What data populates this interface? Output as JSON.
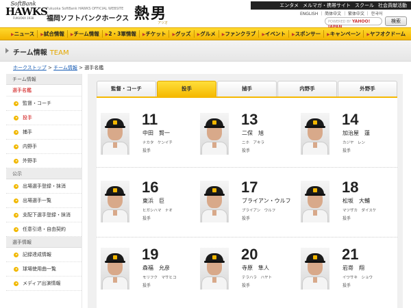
{
  "header": {
    "logo_line1": "SoftBank",
    "logo_line2": "HAWKS",
    "logo_line3": "FUKUOKA 1938",
    "site_tagline": "Fukuoka SoftBank HAWKS OFFICIAL WEBSITE",
    "site_name": "福岡ソフトバンクホークス",
    "hero_title": "熱男",
    "hero_sub": "アツオ",
    "top_links": [
      "エンタメ",
      "メルマガ・携帯サイト",
      "スクール",
      "社会貢献活動"
    ],
    "languages": "ENGLISH ｜ 简体中文 ｜ 繁体中文 ｜ 한국어",
    "search_placeholder": "POWERED BY",
    "search_brand": "YAHOO! JAPAN",
    "search_button": "検索"
  },
  "global_nav": [
    {
      "label": "ニュース"
    },
    {
      "label": "試合情報"
    },
    {
      "label": "チーム情報"
    },
    {
      "label": "2・3軍情報"
    },
    {
      "label": "チケット"
    },
    {
      "label": "グッズ"
    },
    {
      "label": "グルメ"
    },
    {
      "label": "ファンクラブ"
    },
    {
      "label": "イベント"
    },
    {
      "label": "スポンサー"
    },
    {
      "label": "キャンペーン"
    },
    {
      "label": "ヤフオクドーム"
    }
  ],
  "page_header": {
    "title": "チーム情報",
    "title_en": "TEAM"
  },
  "breadcrumb": {
    "home": "ホークストップ",
    "section": "チーム情報",
    "current": "選手名鑑"
  },
  "sidebar": {
    "section1": "チーム情報",
    "current": "選手名鑑",
    "items1": [
      {
        "label": "監督・コーチ"
      },
      {
        "label": "投手"
      },
      {
        "label": "捕手"
      },
      {
        "label": "内野手"
      },
      {
        "label": "外野手"
      }
    ],
    "section2": "公示",
    "items2": [
      {
        "label": "出場選手登録・抹消"
      },
      {
        "label": "出場選手一覧"
      },
      {
        "label": "支配下選手登録・抹消"
      },
      {
        "label": "任意引退・自由契約"
      }
    ],
    "section3": "選手情報",
    "items3": [
      {
        "label": "記録達成情報"
      },
      {
        "label": "球場使用曲一覧"
      },
      {
        "label": "メディア出演情報"
      }
    ]
  },
  "tabs": [
    {
      "label": "監督・コーチ"
    },
    {
      "label": "投手"
    },
    {
      "label": "捕手"
    },
    {
      "label": "内野手"
    },
    {
      "label": "外野手"
    }
  ],
  "active_tab": "投手",
  "accent_color": "#f5b800",
  "players": [
    {
      "number": "11",
      "name": "中田　賢一",
      "kana": "ナカタ　ケンイチ",
      "position": "投手"
    },
    {
      "number": "13",
      "name": "二保　旭",
      "kana": "ニホ　アキラ",
      "position": "投手"
    },
    {
      "number": "14",
      "name": "加治屋　蓮",
      "kana": "カジヤ　レン",
      "position": "投手"
    },
    {
      "number": "16",
      "name": "東浜　巨",
      "kana": "ヒガシハマ　ナオ",
      "position": "投手"
    },
    {
      "number": "17",
      "name": "ブライアン・ウルフ",
      "kana": "ブライアン　ウルフ",
      "position": "投手"
    },
    {
      "number": "18",
      "name": "松坂　大輔",
      "kana": "マツザカ　ダイスケ",
      "position": "投手"
    },
    {
      "number": "19",
      "name": "森福　允彦",
      "kana": "モリフク　マサヒコ",
      "position": "投手"
    },
    {
      "number": "20",
      "name": "寺原　隼人",
      "kana": "テラハラ　ハヤト",
      "position": "投手"
    },
    {
      "number": "21",
      "name": "岩嵜　翔",
      "kana": "イワサキ　ショウ",
      "position": "投手"
    }
  ]
}
